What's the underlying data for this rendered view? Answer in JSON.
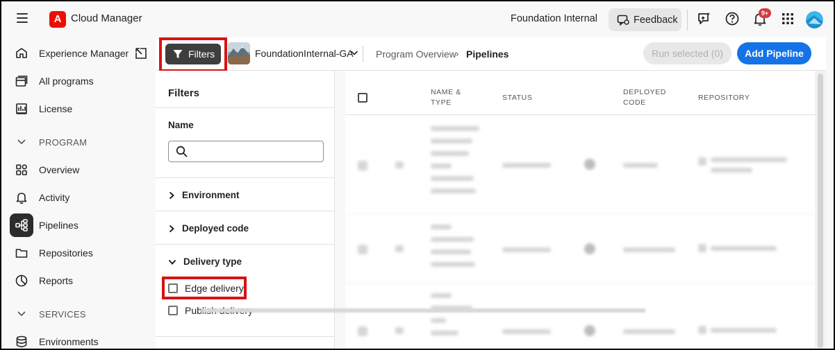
{
  "app": {
    "brand_letter": "A",
    "title": "Cloud Manager",
    "org_name": "Foundation Internal",
    "feedback_label": "Feedback",
    "notification_badge": "9+",
    "brand_color": "#eb1000",
    "accent_color": "#1473e6"
  },
  "sidebar": {
    "items": [
      {
        "label": "Experience Manager",
        "icon": "experience-manager-icon"
      },
      {
        "label": "All programs",
        "icon": "programs-icon"
      },
      {
        "label": "License",
        "icon": "license-icon"
      }
    ],
    "program_section": "PROGRAM",
    "program_items": [
      {
        "label": "Overview",
        "icon": "overview-icon"
      },
      {
        "label": "Activity",
        "icon": "bell-icon"
      },
      {
        "label": "Pipelines",
        "icon": "pipelines-icon",
        "active": true
      },
      {
        "label": "Repositories",
        "icon": "folder-icon"
      },
      {
        "label": "Reports",
        "icon": "reports-icon"
      }
    ],
    "services_section": "SERVICES",
    "services_items": [
      {
        "label": "Environments",
        "icon": "database-icon"
      }
    ]
  },
  "toolbar": {
    "filters_label": "Filters",
    "program_name": "FoundationInternal-GA",
    "breadcrumb": [
      "Program Overview",
      "Pipelines"
    ],
    "run_selected_label": "Run selected (0)",
    "add_pipeline_label": "Add Pipeline"
  },
  "filters": {
    "title": "Filters",
    "name_label": "Name",
    "name_value": "",
    "sections": [
      "Environment",
      "Deployed code",
      "Delivery type"
    ],
    "delivery_options": [
      {
        "label": "Edge delivery",
        "checked": false
      },
      {
        "label": "Publish delivery",
        "checked": false
      }
    ]
  },
  "table": {
    "columns": [
      "NAME & TYPE",
      "STATUS",
      "DEPLOYED CODE",
      "REPOSITORY"
    ]
  }
}
